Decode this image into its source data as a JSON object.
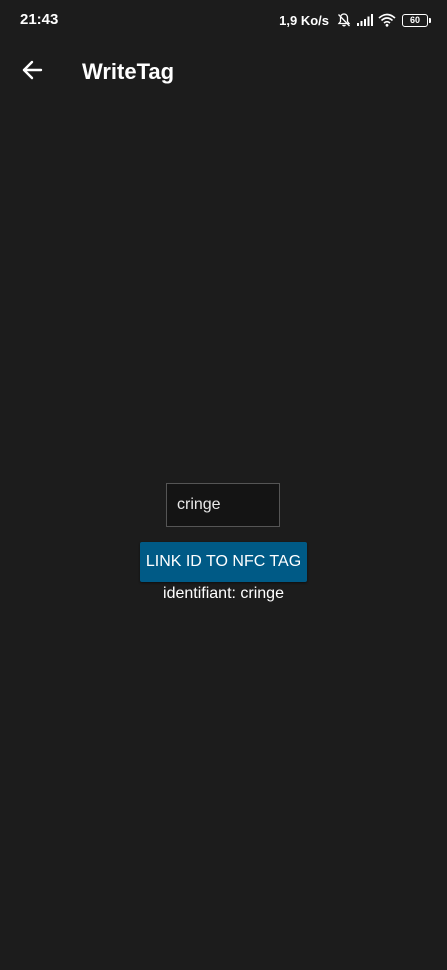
{
  "status_bar": {
    "time": "21:43",
    "net_speed": "1,9 Ko/s",
    "battery_level": "60",
    "icons": [
      "bell-muted-icon",
      "signal-icon",
      "wifi-icon",
      "battery-icon"
    ]
  },
  "app_bar": {
    "back_icon": "arrow-left-icon",
    "title": "WriteTag"
  },
  "main": {
    "id_input": {
      "value": "cringe",
      "placeholder": ""
    },
    "link_button_label": "LINK ID TO NFC TAG",
    "identifiant_text": "identifiant: cringe"
  },
  "colors": {
    "background": "#1c1c1c",
    "button": "#005a86",
    "text": "#ffffff"
  }
}
